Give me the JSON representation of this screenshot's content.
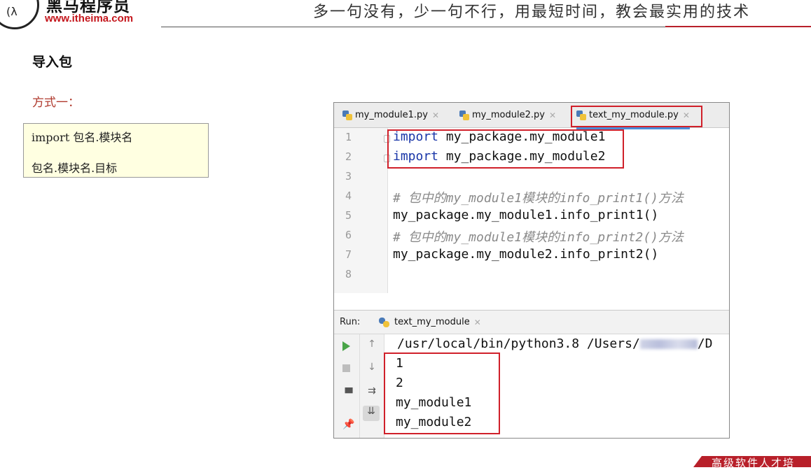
{
  "header": {
    "brand_cn": "黑马程序员",
    "brand_url": "www.itheima.com",
    "slogan": "多一句没有，少一句不行，用最短时间，教会最实用的技术"
  },
  "left": {
    "section_title": "导入包",
    "method_label": "方式一：",
    "code_lines": [
      "import 包名.模块名",
      "包名.模块名.目标"
    ]
  },
  "ide": {
    "tabs": [
      {
        "label": "my_module1.py",
        "active": false
      },
      {
        "label": "my_module2.py",
        "active": false
      },
      {
        "label": "text_my_module.py",
        "active": true
      }
    ],
    "line_numbers": [
      "1",
      "2",
      "3",
      "4",
      "5",
      "6",
      "7",
      "8"
    ],
    "code": {
      "l1_kw": "import",
      "l1_rest": " my_package.my_module1",
      "l2_kw": "import",
      "l2_rest": " my_package.my_module2",
      "l4": "# 包中的my_module1模块的info_print1()方法",
      "l5": "my_package.my_module1.info_print1()",
      "l6": "# 包中的my_module1模块的info_print2()方法",
      "l7": "my_package.my_module2.info_print2()"
    },
    "run": {
      "label": "Run:",
      "tab_label": "text_my_module",
      "command_start": "/usr/local/bin/python3.8 /Users/",
      "command_end": "/D",
      "output": [
        "1",
        "2",
        "my_module1",
        "my_module2"
      ]
    },
    "icons": [
      "python-file-icon",
      "close-icon",
      "run-icon",
      "stop-icon",
      "up-arrow-icon",
      "down-arrow-icon",
      "soft-wrap-icon",
      "scroll-to-end-icon",
      "layout-icon",
      "pin-icon"
    ],
    "colors": {
      "highlight_box": "#d0202a",
      "keyword": "#1a36a8",
      "comment": "#8a8a8a"
    }
  },
  "footer": {
    "text": "高级软件人才培"
  }
}
